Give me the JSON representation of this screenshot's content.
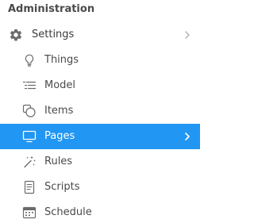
{
  "section": {
    "title": "Administration"
  },
  "menu": {
    "parent": {
      "label": "Settings",
      "icon": "gear-icon"
    },
    "items": [
      {
        "label": "Things",
        "icon": "lightbulb-icon"
      },
      {
        "label": "Model",
        "icon": "list-tree-icon"
      },
      {
        "label": "Items",
        "icon": "items-circles-icon"
      },
      {
        "label": "Pages",
        "icon": "monitor-icon",
        "active": true
      },
      {
        "label": "Rules",
        "icon": "magic-wand-icon"
      },
      {
        "label": "Scripts",
        "icon": "document-icon"
      },
      {
        "label": "Schedule",
        "icon": "calendar-icon"
      }
    ]
  },
  "colors": {
    "active_background": "#2196f3",
    "text": "#4a4a4a",
    "icon": "#6b6b6b",
    "active_text": "#ffffff"
  }
}
